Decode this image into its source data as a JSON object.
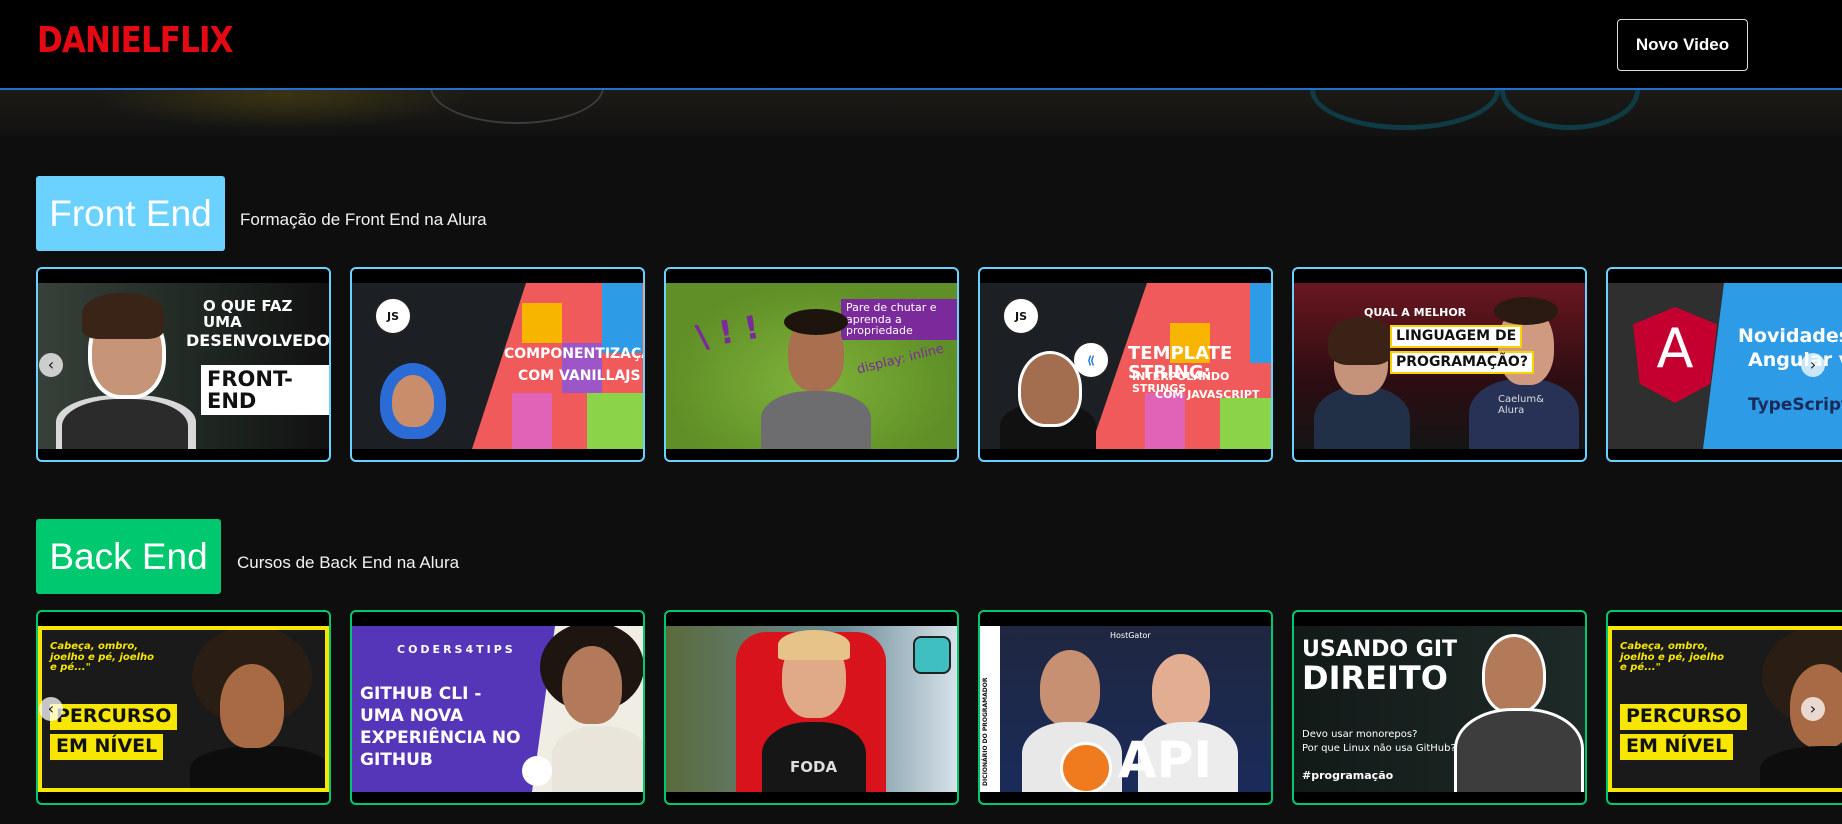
{
  "header": {
    "logo": "DANIELFLIX",
    "new_video_label": "Novo Video"
  },
  "categories": [
    {
      "id": "front-end",
      "title": "Front End",
      "description": "Formação de Front End na Alura",
      "color": "#6bd1ff",
      "videos": [
        {
          "lines": [
            "O QUE FAZ UMA",
            "DESENVOLVEDORA",
            "FRONT-END"
          ]
        },
        {
          "badges": [
            "JS"
          ],
          "lines": [
            "COMPONENTIZAÇÃO",
            "COM VANILLAJS"
          ]
        },
        {
          "caption": "Pare de chutar e aprenda a propriedade",
          "tag": "display: inline"
        },
        {
          "badges": [
            "JS"
          ],
          "lines": [
            "TEMPLATE STRING:",
            "INTERPOLANDO STRINGS",
            "COM JAVASCRIPT"
          ]
        },
        {
          "lines": [
            "QUAL A MELHOR",
            "LINGUAGEM DE",
            "PROGRAMAÇÃO?"
          ],
          "shirt": "Caelum& Alura"
        },
        {
          "logo": "A",
          "lines": [
            "Novidades",
            "Angular v"
          ],
          "tag": "TypeScript"
        }
      ]
    },
    {
      "id": "back-end",
      "title": "Back End",
      "description": "Cursos de Back End na Alura",
      "color": "#00c86f",
      "videos": [
        {
          "quote": "Cabeça, ombro, joelho e pé, joelho e pé...\"",
          "lines": [
            "PERCURSO",
            "EM NÍVEL"
          ]
        },
        {
          "brand": "CODERS4TIPS",
          "lines": [
            "GITHUB CLI -",
            "UMA NOVA",
            "EXPERIÊNCIA NO",
            "GITHUB"
          ]
        },
        {
          "shirt": "FODA"
        },
        {
          "side": "DICIONÁRIO DO PROGRAMADOR",
          "brand": "HostGator",
          "lines": [
            "API"
          ]
        },
        {
          "lines": [
            "USANDO GIT",
            "DIREITO"
          ],
          "sub": [
            "Devo usar monorepos?",
            "Por que Linux não usa GitHub?"
          ],
          "tag": "#programação"
        },
        {
          "quote": "Cabeça, ombro, joelho e pé, joelho e pé...\"",
          "lines": [
            "PERCURSO",
            "EM NÍVEL"
          ]
        }
      ]
    }
  ],
  "carousel": {
    "prev_icon": "‹",
    "next_icon": "›"
  }
}
